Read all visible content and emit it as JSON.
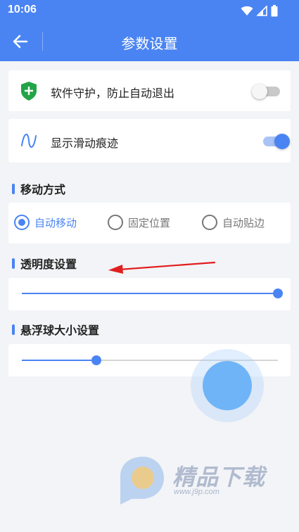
{
  "status_bar": {
    "time": "10:06",
    "icons": [
      "wifi-icon",
      "signal-icon",
      "battery-icon"
    ]
  },
  "appbar": {
    "title": "参数设置",
    "back_icon": "arrow-left-icon"
  },
  "settings": {
    "keep_alive": {
      "label": "软件守护，防止自动退出",
      "icon": "shield-plus-icon",
      "enabled": false
    },
    "show_trail": {
      "label": "显示滑动痕迹",
      "icon": "wave-icon",
      "enabled": true
    }
  },
  "move_mode": {
    "title": "移动方式",
    "options": [
      {
        "label": "自动移动",
        "selected": true
      },
      {
        "label": "固定位置",
        "selected": false
      },
      {
        "label": "自动贴边",
        "selected": false
      }
    ]
  },
  "opacity": {
    "title": "透明度设置",
    "value": 1.0
  },
  "ball_size": {
    "title": "悬浮球大小设置",
    "value": 0.29
  },
  "watermark": {
    "text": "精品下载",
    "url": "www.j9p.com"
  },
  "colors": {
    "accent": "#4a84f3",
    "ball": "#6fb4f7",
    "annotation_arrow": "#e11e1e"
  }
}
